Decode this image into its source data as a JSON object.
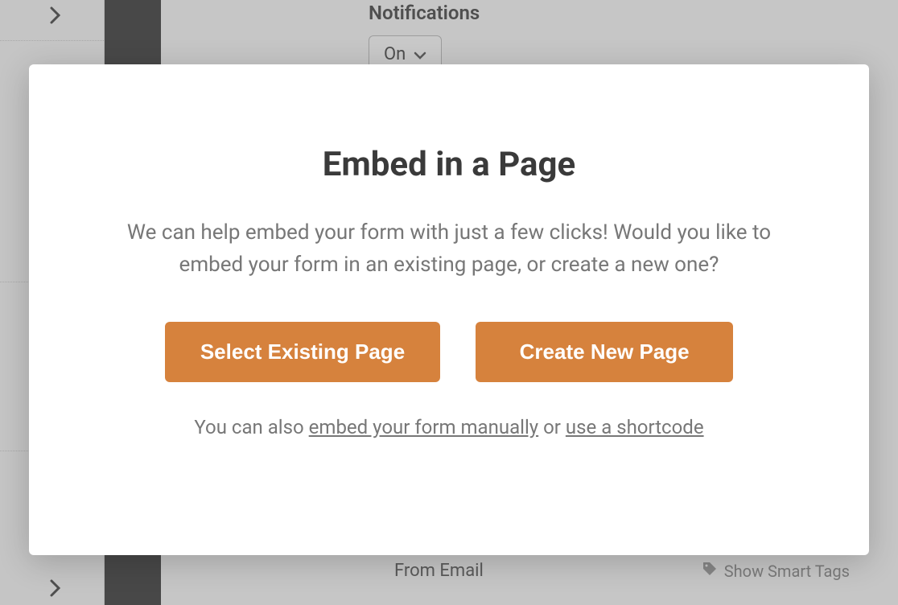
{
  "background": {
    "notifications_label": "Notifications",
    "notifications_value": "On",
    "from_email_label": "From Email",
    "smart_tags_label": "Show Smart Tags"
  },
  "modal": {
    "title": "Embed in a Page",
    "description": "We can help embed your form with just a few clicks! Would you like to embed your form in an existing page, or create a new one?",
    "select_existing_label": "Select Existing Page",
    "create_new_label": "Create New Page",
    "footer_prefix": "You can also ",
    "footer_link_manual": "embed your form manually",
    "footer_middle": " or ",
    "footer_link_shortcode": "use a shortcode"
  },
  "colors": {
    "accent": "#d6823d"
  }
}
